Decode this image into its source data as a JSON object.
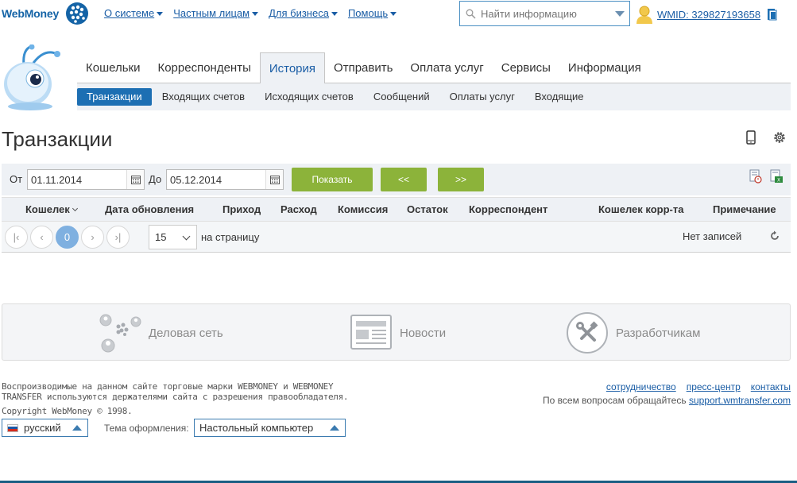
{
  "header": {
    "logo_text": "WebMoney",
    "nav": [
      {
        "label": "О системе"
      },
      {
        "label": "Частным лицам"
      },
      {
        "label": "Для бизнеса"
      },
      {
        "label": "Помощь"
      }
    ],
    "search_placeholder": "Найти информацию",
    "wmid": "WMID: 329827193658"
  },
  "main_tabs": [
    {
      "label": "Кошельки"
    },
    {
      "label": "Корреспонденты"
    },
    {
      "label": "История"
    },
    {
      "label": "Отправить"
    },
    {
      "label": "Оплата услуг"
    },
    {
      "label": "Сервисы"
    },
    {
      "label": "Информация"
    }
  ],
  "sub_tabs": [
    {
      "label": "Транзакции"
    },
    {
      "label": "Входящих счетов"
    },
    {
      "label": "Исходящих счетов"
    },
    {
      "label": "Сообщений"
    },
    {
      "label": "Оплаты услуг"
    },
    {
      "label": "Входящие"
    }
  ],
  "page_title": "Транзакции",
  "filter": {
    "from_label": "От",
    "from_value": "01.11.2014",
    "to_label": "До",
    "to_value": "05.12.2014",
    "show_label": "Показать",
    "prev_label": "<<",
    "next_label": ">>"
  },
  "table": {
    "columns": [
      "Кошелек",
      "Дата обновления",
      "Приход",
      "Расход",
      "Комиссия",
      "Остаток",
      "Корреспондент",
      "Кошелек корр-та",
      "Примечание"
    ]
  },
  "pager": {
    "first": "|‹",
    "prev": "‹",
    "current": "0",
    "next": "›",
    "last": "›|",
    "per_page_value": "15",
    "per_page_label": "на страницу",
    "no_records": "Нет записей"
  },
  "links_panel": [
    {
      "label": "Деловая сеть",
      "icon": "business-network-icon"
    },
    {
      "label": "Новости",
      "icon": "news-icon"
    },
    {
      "label": "Разработчикам",
      "icon": "developers-tools-icon"
    }
  ],
  "footer": {
    "trademark_text": "Воспроизводимые на данном сайте торговые марки WEBMONEY и WEBMONEY TRANSFER используются держателями сайта с разрешения правообладателя.",
    "copyright": "Copyright WebMoney © 1998.",
    "links": [
      {
        "label": "сотрудничество"
      },
      {
        "label": "пресс-центр"
      },
      {
        "label": "контакты"
      }
    ],
    "contact_text": "По всем вопросам обращайтесь",
    "contact_link": "support.wmtransfer.com",
    "language": "русский",
    "theme_label": "Тема оформления:",
    "theme_value": "Настольный компьютер"
  },
  "colors": {
    "brand_blue": "#1463a6",
    "active_subtab": "#1d6fb3",
    "green_button": "#8cb33a",
    "panel_bg": "#eef1f5"
  }
}
